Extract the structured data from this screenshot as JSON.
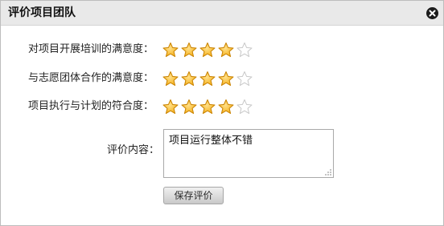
{
  "dialog": {
    "title": "评价项目团队",
    "close_icon": "close-icon"
  },
  "ratings": [
    {
      "label": "对项目开展培训的满意度：",
      "value": 4,
      "max": 5
    },
    {
      "label": "与志愿团体合作的满意度：",
      "value": 4,
      "max": 5
    },
    {
      "label": "项目执行与计划的符合度：",
      "value": 4,
      "max": 5
    }
  ],
  "comment": {
    "label": "评价内容：",
    "value": "项目运行整体不错"
  },
  "save_button": {
    "label": "保存评价"
  },
  "colors": {
    "star_filled": "#f5b21e",
    "star_empty": "#ffffff",
    "titlebar": "#e9e9e9"
  }
}
